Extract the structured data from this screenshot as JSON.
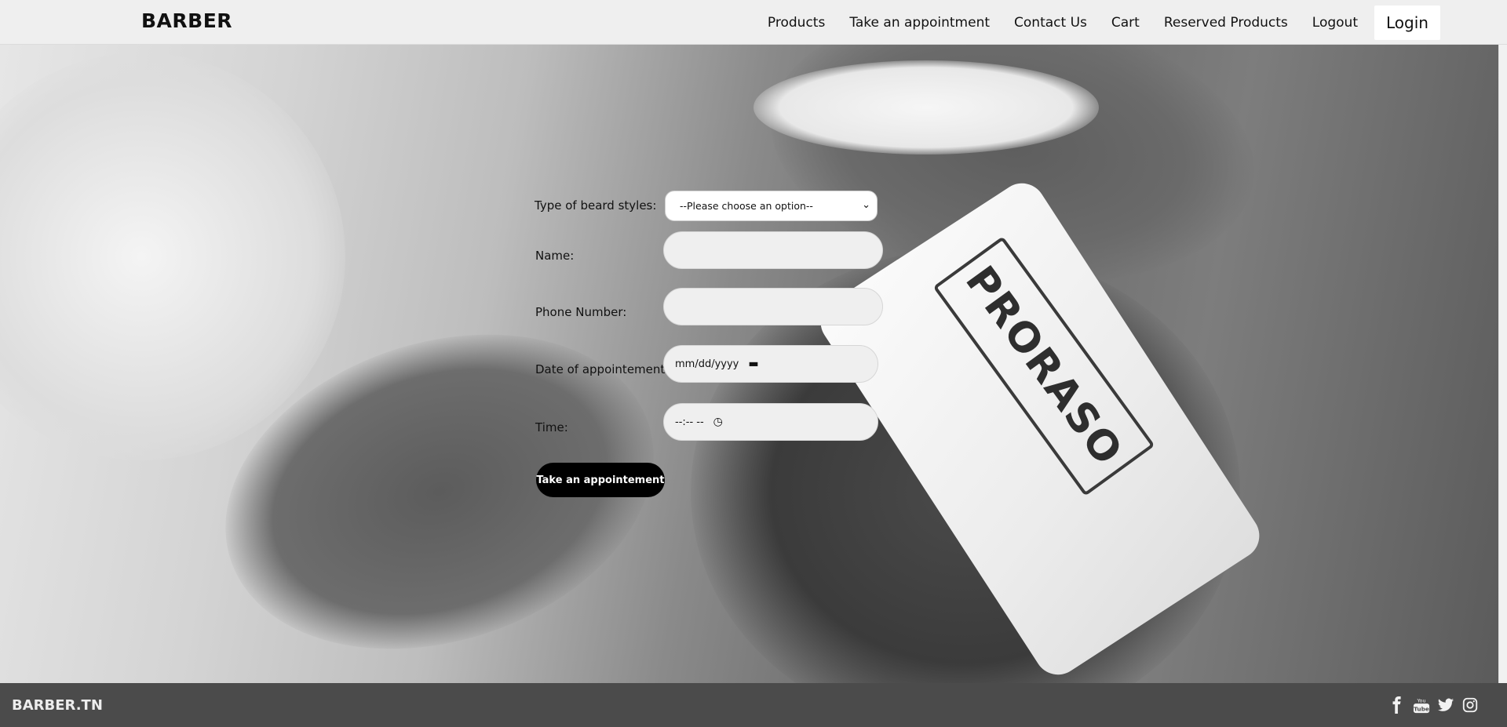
{
  "header": {
    "brand": "BARBER",
    "nav": [
      "Products",
      "Take an appointment",
      "Contact Us",
      "Cart",
      "Reserved Products",
      "Logout"
    ],
    "login": "Login"
  },
  "hero": {
    "towel_text": "PRORASO"
  },
  "form": {
    "beard_label": "Type of beard styles:",
    "beard_selected": "--Please choose an option--",
    "name_label": "Name:",
    "name_value": "",
    "phone_label": "Phone Number:",
    "phone_value": "",
    "date_label": "Date of appointement:",
    "date_placeholder": "mm/dd/yyyy",
    "time_label": "Time:",
    "time_placeholder": "--:-- --",
    "submit": "Take an appointement"
  },
  "footer": {
    "brand": "BARBER.TN",
    "social_icons": [
      "facebook-icon",
      "youtube-icon",
      "twitter-icon",
      "instagram-icon"
    ]
  }
}
